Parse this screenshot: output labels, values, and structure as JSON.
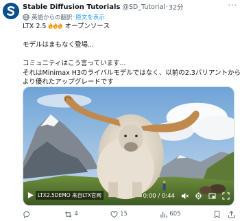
{
  "author": {
    "name": "Stable Diffusion Tutorials",
    "handle": "@SD_Tutorial",
    "separator": "·",
    "time": "32分"
  },
  "translate": {
    "label": "英語からの翻訳",
    "separator": "·",
    "show_original": "原文を表示"
  },
  "post": {
    "line1": "LTX 2.5",
    "line1_suffix": "オープンソース",
    "line2": "モデルはまもなく登場...",
    "line3": "コミュニティはこう言っています...",
    "line4": "それはMinimax H3のライバルモデルではなく、以前の2.3バリアントからの",
    "line5": "より優れたアップグレードです"
  },
  "video": {
    "caption": "LTX2.5DEMO 来自LTX官网",
    "time_display": "0:00 / 0:44"
  },
  "actions": {
    "reply_count": "",
    "retweet_count": "4",
    "like_count": "15",
    "views_count": "605"
  },
  "colors": {
    "accent": "#1d9bf0",
    "secondary_text": "#536471",
    "avatar_bg": "#0d5a9e"
  }
}
